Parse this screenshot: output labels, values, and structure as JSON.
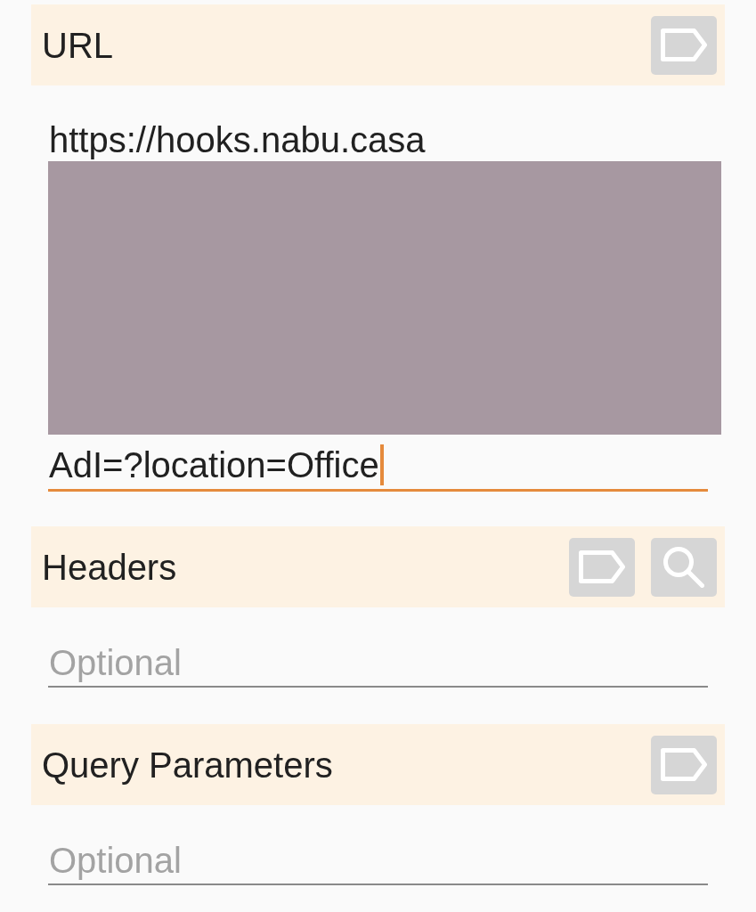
{
  "sections": [
    {
      "title": "URL",
      "actions": [
        {
          "kind": "tag"
        }
      ],
      "field": {
        "kind": "multiline",
        "lines": [
          "https://hooks.nabu.casa",
          "AdI=?location=Office"
        ],
        "redacted": true,
        "focused": true
      }
    },
    {
      "title": "Headers",
      "actions": [
        {
          "kind": "tag"
        },
        {
          "kind": "search"
        }
      ],
      "field": {
        "kind": "input",
        "placeholder": "Optional",
        "focused": false
      }
    },
    {
      "title": "Query Parameters",
      "actions": [
        {
          "kind": "tag"
        }
      ],
      "field": {
        "kind": "input",
        "placeholder": "Optional",
        "focused": false
      }
    }
  ]
}
